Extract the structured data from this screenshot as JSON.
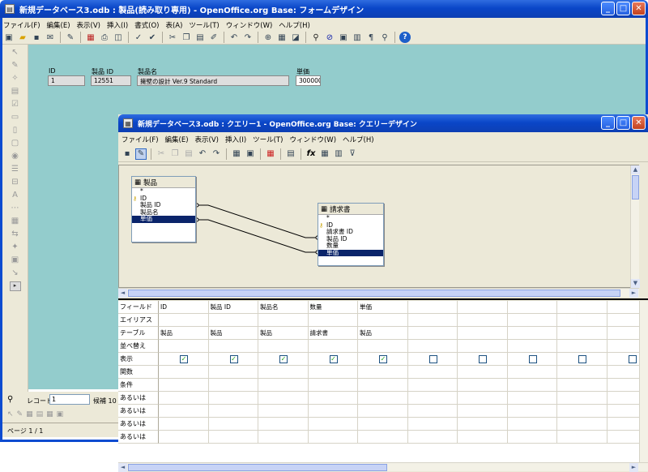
{
  "form_window": {
    "title": "新規データベース3.odb : 製品(読み取り専用) - OpenOffice.org Base: フォームデザイン",
    "menu": [
      "ファイル(F)",
      "編集(E)",
      "表示(V)",
      "挿入(I)",
      "書式(O)",
      "表(A)",
      "ツール(T)",
      "ウィンドウ(W)",
      "ヘルプ(H)"
    ],
    "fields": {
      "id_label": "ID",
      "id_value": "1",
      "product_id_label": "製品 ID",
      "product_id_value": "12551",
      "product_name_label": "製品名",
      "product_name_value": "擁壁の設計 Ver.9 Standard",
      "price_label": "単価",
      "price_value": "300000"
    },
    "record_label": "レコード",
    "record_value": "1",
    "record_candidates": "候補 10",
    "page_status": "ページ 1 / 1"
  },
  "query_window": {
    "title": "新規データベース3.odb : クエリー1 - OpenOffice.org Base: クエリーデザイン",
    "menu": [
      "ファイル(F)",
      "編集(E)",
      "表示(V)",
      "挿入(I)",
      "ツール(T)",
      "ウィンドウ(W)",
      "ヘルプ(H)"
    ],
    "table1": {
      "name": "製品",
      "fields": [
        "*",
        "ID",
        "製品 ID",
        "製品名",
        "単価"
      ]
    },
    "table2": {
      "name": "請求書",
      "fields": [
        "*",
        "ID",
        "請求書 ID",
        "製品 ID",
        "数量",
        "単価"
      ]
    },
    "grid_labels": [
      "フィールド",
      "エイリアス",
      "テーブル",
      "並べ替え",
      "表示",
      "関数",
      "条件",
      "あるいは",
      "あるいは",
      "あるいは",
      "あるいは"
    ],
    "columns": [
      {
        "field": "ID",
        "table": "製品",
        "visible": true
      },
      {
        "field": "製品 ID",
        "table": "製品",
        "visible": true
      },
      {
        "field": "製品名",
        "table": "製品",
        "visible": true
      },
      {
        "field": "数量",
        "table": "請求書",
        "visible": true
      },
      {
        "field": "単価",
        "table": "製品",
        "visible": true
      },
      {
        "field": "",
        "table": "",
        "visible": false
      },
      {
        "field": "",
        "table": "",
        "visible": false
      },
      {
        "field": "",
        "table": "",
        "visible": false
      },
      {
        "field": "",
        "table": "",
        "visible": false
      },
      {
        "field": "",
        "table": "",
        "visible": false
      }
    ]
  },
  "colors": {
    "title_bar": "#0a46c8",
    "form_bg": "#93cccc",
    "selection": "#0a246a",
    "check": "#21a121"
  }
}
